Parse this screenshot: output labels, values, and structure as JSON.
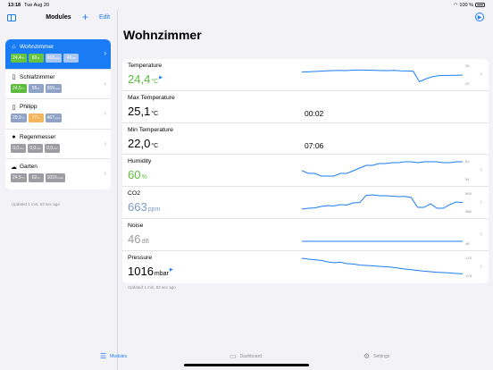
{
  "status": {
    "time": "13:18",
    "date": "Tue Aug 20",
    "battery": "100 %"
  },
  "sidebar": {
    "title": "Modules",
    "edit_label": "Edit",
    "updated": "Updated 1 min, 53 sec ago",
    "modules": [
      {
        "name": "Wohnzimmer",
        "icon": "house-icon",
        "selected": true,
        "badges": [
          {
            "v": "24,4",
            "u": "°C",
            "c": "green"
          },
          {
            "v": "60",
            "u": "%",
            "c": "green"
          },
          {
            "v": "663",
            "u": "ppm",
            "c": "blue"
          },
          {
            "v": "46",
            "u": "dB",
            "c": "blue"
          }
        ]
      },
      {
        "name": "Schlafzimmer",
        "icon": "phone-icon",
        "selected": false,
        "badges": [
          {
            "v": "24,5",
            "u": "°C",
            "c": "green"
          },
          {
            "v": "55",
            "u": "%",
            "c": "blue"
          },
          {
            "v": "559",
            "u": "ppm",
            "c": "blue"
          }
        ]
      },
      {
        "name": "Philipp",
        "icon": "phone-icon",
        "selected": false,
        "badges": [
          {
            "v": "20,9",
            "u": "°C",
            "c": "blue"
          },
          {
            "v": "77",
            "u": "%",
            "c": "orange"
          },
          {
            "v": "467",
            "u": "ppm",
            "c": "blue"
          }
        ]
      },
      {
        "name": "Regenmesser",
        "icon": "drop-icon",
        "selected": false,
        "badges": [
          {
            "v": "0,0",
            "u": "mm",
            "c": "gray"
          },
          {
            "v": "0,0",
            "u": "mm",
            "c": "gray"
          },
          {
            "v": "0,0",
            "u": "mm",
            "c": "gray"
          }
        ]
      },
      {
        "name": "Garten",
        "icon": "cloud-sun-icon",
        "selected": false,
        "badges": [
          {
            "v": "24,5",
            "u": "°C",
            "c": "gray"
          },
          {
            "v": "62",
            "u": "%",
            "c": "gray"
          },
          {
            "v": "1016",
            "u": "mbar",
            "c": "gray"
          }
        ]
      }
    ]
  },
  "main": {
    "title": "Wohnzimmer",
    "updated": "Updated 1 min, 52 sec ago",
    "rows": [
      {
        "label": "Temperature",
        "value": "24,4",
        "unit": "°C",
        "color": "green",
        "trend": true,
        "spark": {
          "max": "25",
          "min": "22",
          "points": [
            0.42,
            0.42,
            0.4,
            0.38,
            0.36,
            0.35,
            0.34,
            0.35,
            0.33,
            0.32,
            0.32,
            0.33,
            0.34,
            0.35,
            0.35,
            0.34,
            0.36,
            0.37,
            0.38,
            0.97,
            0.82,
            0.7,
            0.64,
            0.62,
            0.62,
            0.61,
            0.6
          ]
        }
      },
      {
        "label": "Max Temperature",
        "value": "25,1",
        "unit": "°C",
        "color": "black",
        "time": "00:02"
      },
      {
        "label": "Min Temperature",
        "value": "22,0",
        "unit": "°C",
        "color": "black",
        "time": "07:06"
      },
      {
        "label": "Humidity",
        "value": "60",
        "unit": "%",
        "color": "green",
        "spark": {
          "max": "61",
          "min": "54",
          "points": [
            0.6,
            0.75,
            0.75,
            0.9,
            0.9,
            0.9,
            0.75,
            0.75,
            0.6,
            0.45,
            0.3,
            0.3,
            0.2,
            0.2,
            0.15,
            0.15,
            0.1,
            0.1,
            0.15,
            0.1,
            0.1,
            0.1,
            0.15,
            0.15,
            0.1,
            0.1
          ]
        }
      },
      {
        "label": "CO2",
        "value": "663",
        "unit": "ppm",
        "color": "blue",
        "spark": {
          "max": "993",
          "min": "366",
          "points": [
            0.95,
            0.9,
            0.88,
            0.8,
            0.75,
            0.77,
            0.7,
            0.72,
            0.6,
            0.58,
            0.18,
            0.15,
            0.2,
            0.2,
            0.22,
            0.25,
            0.24,
            0.3,
            0.85,
            0.85,
            0.65,
            0.9,
            0.9,
            0.7,
            0.55,
            0.58
          ]
        }
      },
      {
        "label": "Noise",
        "value": "46",
        "unit": "dB",
        "color": "gray",
        "spark": {
          "max": "",
          "min": "46",
          "points": [
            0.95,
            0.95,
            0.95,
            0.95,
            0.95,
            0.95,
            0.95,
            0.95,
            0.95,
            0.95,
            0.95,
            0.95,
            0.95,
            0.95,
            0.95,
            0.95,
            0.95,
            0.95,
            0.95,
            0.95,
            0.95,
            0.95,
            0.95,
            0.95,
            0.95,
            0.95
          ]
        }
      },
      {
        "label": "Pressure",
        "value": "1016",
        "unit": "mbar",
        "color": "black",
        "trend": true,
        "spark": {
          "max": "1,031",
          "min": "1,016",
          "points": [
            0.1,
            0.15,
            0.18,
            0.22,
            0.3,
            0.35,
            0.32,
            0.4,
            0.42,
            0.48,
            0.5,
            0.52,
            0.55,
            0.57,
            0.6,
            0.65,
            0.7,
            0.74,
            0.78,
            0.82,
            0.85,
            0.88,
            0.9,
            0.92,
            0.95,
            0.97
          ]
        }
      }
    ]
  },
  "tabs": [
    {
      "label": "Modules",
      "icon": "list-icon",
      "active": true
    },
    {
      "label": "Dashboard",
      "icon": "dashboard-icon",
      "active": false
    },
    {
      "label": "Settings",
      "icon": "gear-icon",
      "active": false
    }
  ]
}
